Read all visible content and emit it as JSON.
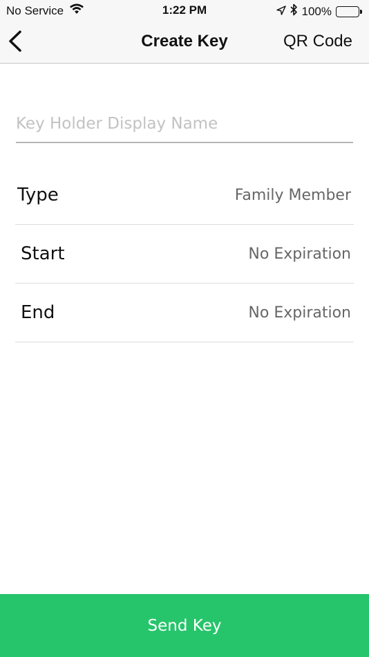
{
  "status_bar": {
    "carrier": "No Service",
    "time": "1:22 PM",
    "battery": "100%",
    "battery_level": 1.0,
    "icons": [
      "wifi-icon",
      "location-arrow-icon",
      "bluetooth-icon",
      "battery-icon"
    ]
  },
  "nav": {
    "back_icon": "chevron-left-icon",
    "title": "Create Key",
    "action": "QR Code"
  },
  "form": {
    "name_placeholder": "Key Holder Display Name",
    "name_value": "",
    "rows": [
      {
        "label": "Type",
        "value": "Family Member"
      },
      {
        "label": "Start",
        "value": "No Expiration"
      },
      {
        "label": "End",
        "value": "No Expiration"
      }
    ]
  },
  "footer": {
    "send_label": "Send Key"
  },
  "colors": {
    "accent": "#26c56b",
    "bar_background": "#f7f7f7",
    "value_text": "#666666",
    "placeholder": "#c2c2c2"
  }
}
